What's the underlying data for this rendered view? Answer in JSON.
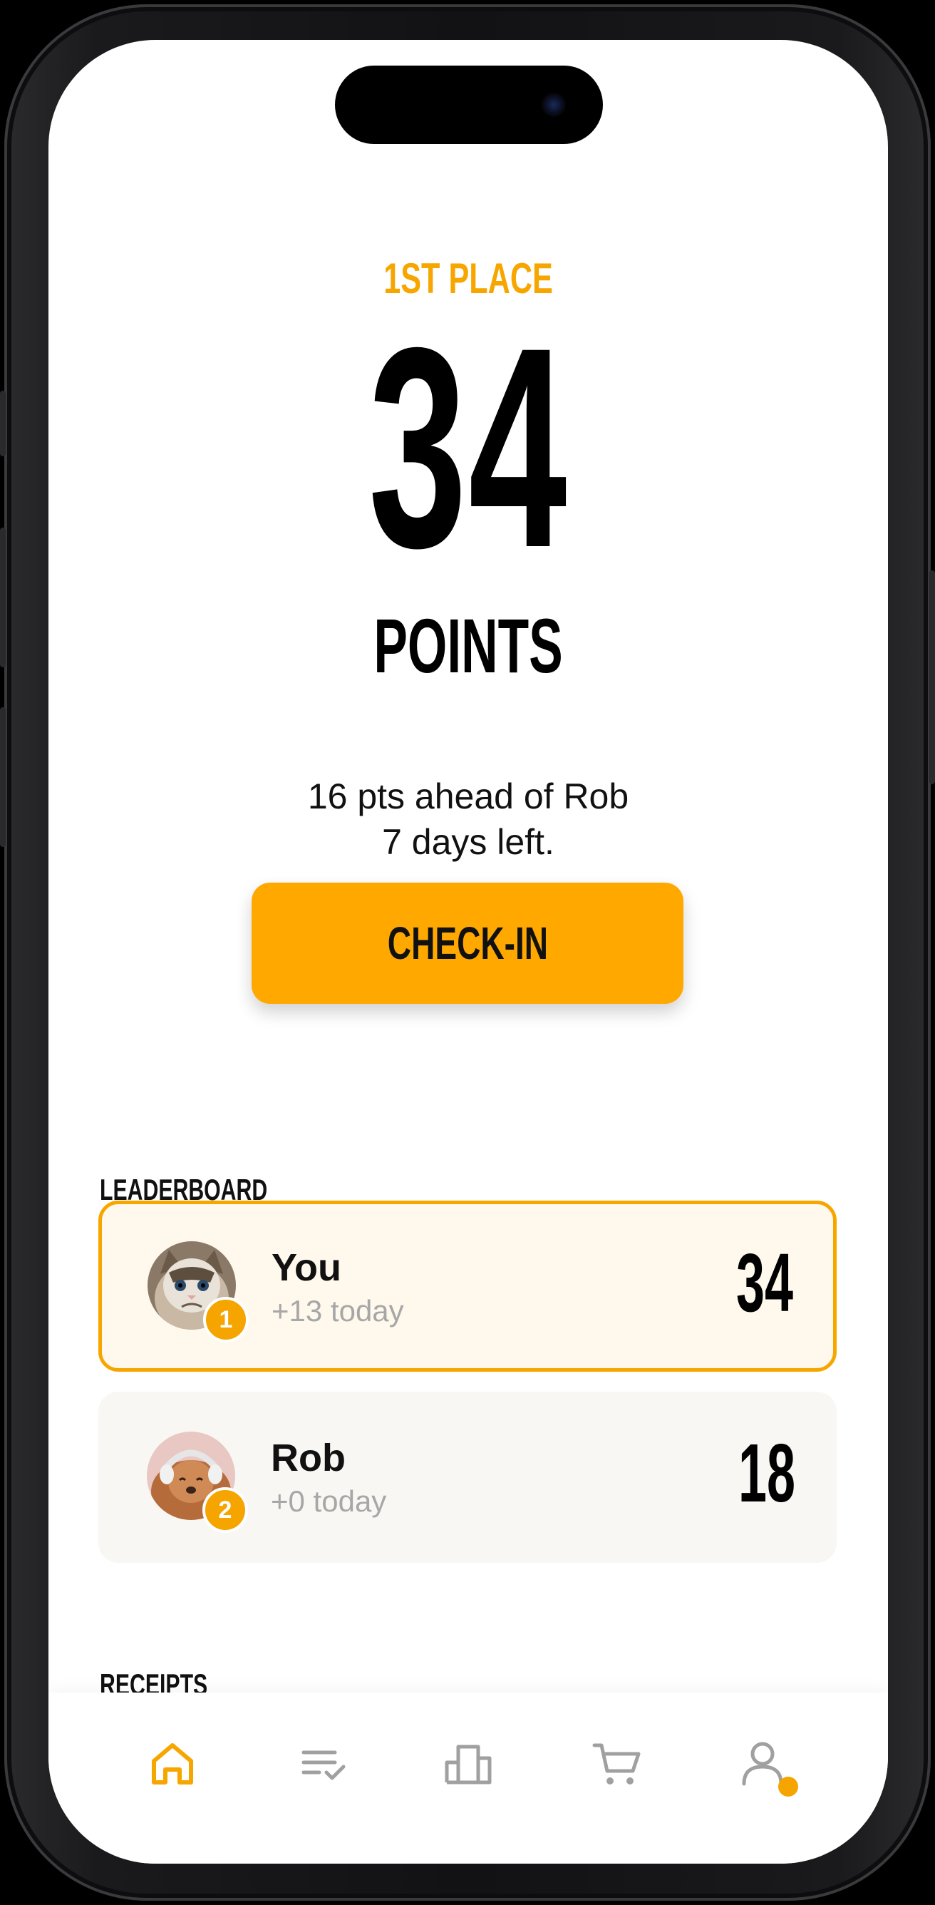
{
  "hero": {
    "place": "1ST PLACE",
    "points": "34",
    "points_label": "POINTS",
    "lead_line": "16 pts ahead of Rob",
    "days_line": "7 days left.",
    "checkin_label": "CHECK-IN"
  },
  "leaderboard": {
    "title": "LEADERBOARD",
    "entries": [
      {
        "rank": "1",
        "name": "You",
        "today": "+13 today",
        "score": "34",
        "avatar": "grumpy-cat-avatar"
      },
      {
        "rank": "2",
        "name": "Rob",
        "today": "+0 today",
        "score": "18",
        "avatar": "dog-headphones-avatar"
      }
    ]
  },
  "receipts": {
    "title": "RECEIPTS"
  },
  "tabbar": {
    "items": [
      "home-icon",
      "checklist-icon",
      "bar-chart-icon",
      "cart-icon",
      "profile-icon"
    ],
    "active": "home-icon"
  },
  "colors": {
    "accent": "#f7a600",
    "highlight_bg": "#fff8ec",
    "card_bg": "#f8f7f4",
    "muted_text": "#a7a7a7",
    "inactive_icon": "#a0a0a0"
  }
}
